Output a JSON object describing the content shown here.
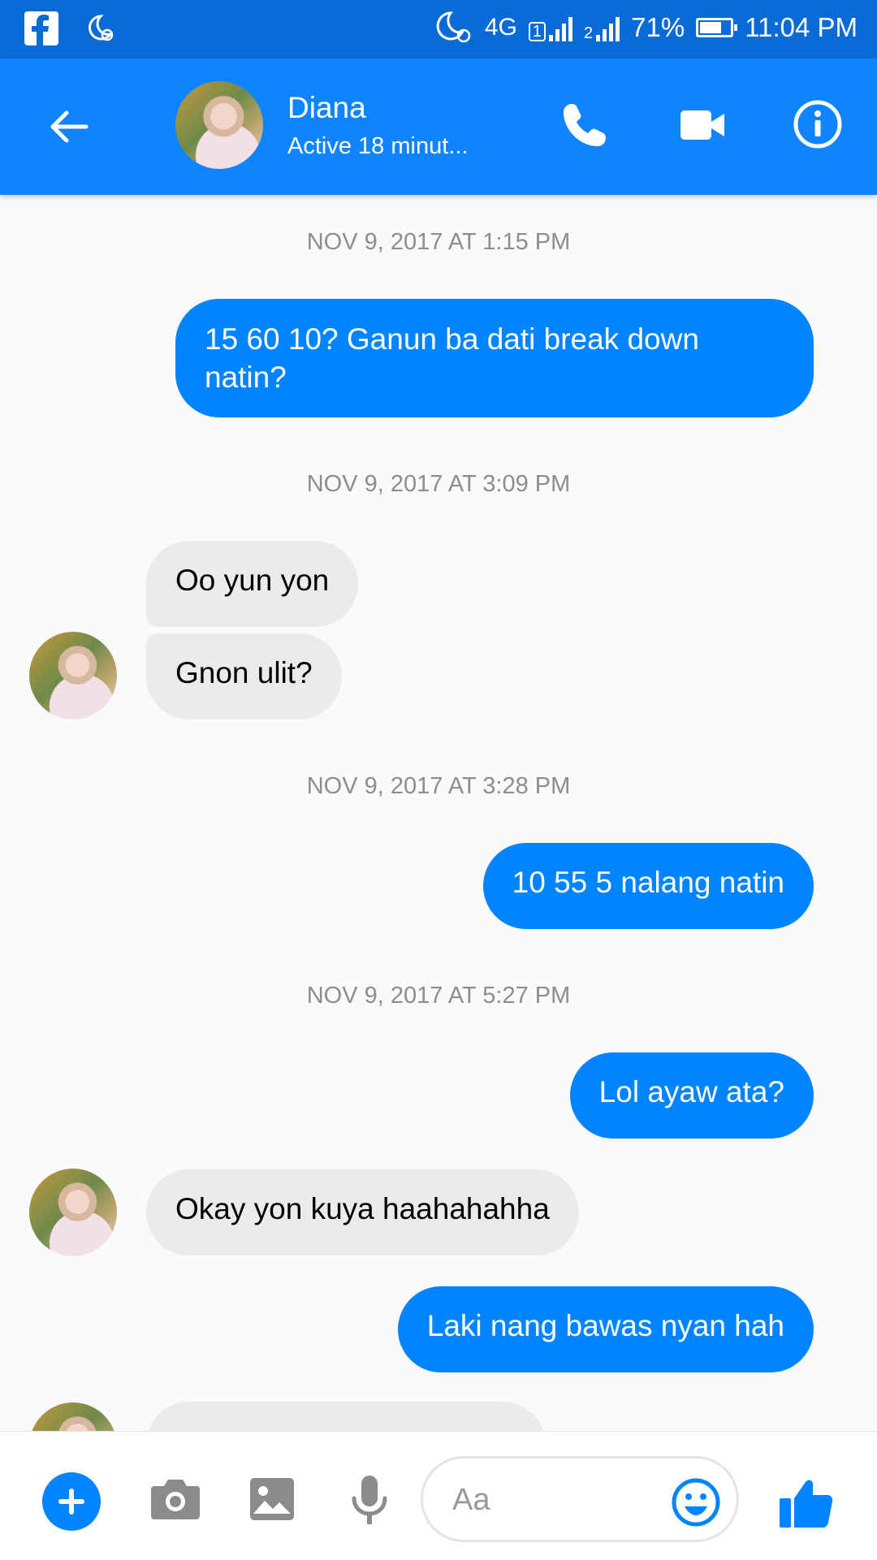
{
  "status_bar": {
    "network": "4G",
    "sim1_label": "1",
    "sim2_label": "2",
    "battery": "71%",
    "battery_level": 0.71,
    "time": "11:04 PM"
  },
  "header": {
    "name": "Diana",
    "status": "Active 18 minut..."
  },
  "thread": {
    "timestamps": [
      "NOV 9, 2017 AT 1:15 PM",
      "NOV 9, 2017 AT 3:09 PM",
      "NOV 9, 2017 AT 3:28 PM",
      "NOV 9, 2017 AT 5:27 PM"
    ],
    "messages": [
      {
        "from": "me",
        "text": "15 60 10? Ganun ba dati break down natin?"
      },
      {
        "from": "Diana",
        "text": "Oo yun yon"
      },
      {
        "from": "Diana",
        "text": "Gnon ulit?"
      },
      {
        "from": "me",
        "text": "10 55 5 nalang natin"
      },
      {
        "from": "me",
        "text": "Lol ayaw ata?"
      },
      {
        "from": "Diana",
        "text": "Okay yon kuya haahahahha"
      },
      {
        "from": "me",
        "text": "Laki  nang bawas nyan hah"
      }
    ]
  },
  "composer": {
    "placeholder": "Aa"
  },
  "colors": {
    "header": "#0e84ff",
    "status_bar": "#0a6ad6",
    "outgoing_bubble": "#0084ff",
    "incoming_bubble": "#ebebeb"
  }
}
